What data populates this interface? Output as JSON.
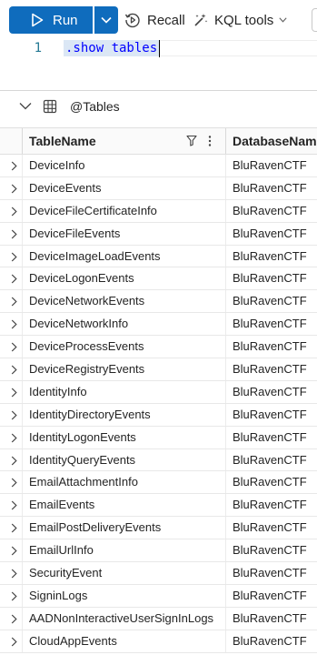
{
  "toolbar": {
    "run_label": "Run",
    "recall_label": "Recall",
    "kql_tools_label": "KQL tools"
  },
  "editor": {
    "line_number": "1",
    "query": ".show tables"
  },
  "results": {
    "title": "@Tables",
    "columns": [
      "TableName",
      "DatabaseName"
    ],
    "rows": [
      [
        "DeviceInfo",
        "BluRavenCTF"
      ],
      [
        "DeviceEvents",
        "BluRavenCTF"
      ],
      [
        "DeviceFileCertificateInfo",
        "BluRavenCTF"
      ],
      [
        "DeviceFileEvents",
        "BluRavenCTF"
      ],
      [
        "DeviceImageLoadEvents",
        "BluRavenCTF"
      ],
      [
        "DeviceLogonEvents",
        "BluRavenCTF"
      ],
      [
        "DeviceNetworkEvents",
        "BluRavenCTF"
      ],
      [
        "DeviceNetworkInfo",
        "BluRavenCTF"
      ],
      [
        "DeviceProcessEvents",
        "BluRavenCTF"
      ],
      [
        "DeviceRegistryEvents",
        "BluRavenCTF"
      ],
      [
        "IdentityInfo",
        "BluRavenCTF"
      ],
      [
        "IdentityDirectoryEvents",
        "BluRavenCTF"
      ],
      [
        "IdentityLogonEvents",
        "BluRavenCTF"
      ],
      [
        "IdentityQueryEvents",
        "BluRavenCTF"
      ],
      [
        "EmailAttachmentInfo",
        "BluRavenCTF"
      ],
      [
        "EmailEvents",
        "BluRavenCTF"
      ],
      [
        "EmailPostDeliveryEvents",
        "BluRavenCTF"
      ],
      [
        "EmailUrlInfo",
        "BluRavenCTF"
      ],
      [
        "SecurityEvent",
        "BluRavenCTF"
      ],
      [
        "SigninLogs",
        "BluRavenCTF"
      ],
      [
        "AADNonInteractiveUserSignInLogs",
        "BluRavenCTF"
      ],
      [
        "CloudAppEvents",
        "BluRavenCTF"
      ]
    ]
  },
  "icons": {
    "run": "play-icon",
    "run_dropdown": "chevron-down-icon",
    "recall": "recall-icon",
    "kql_tools": "magic-wand-icon",
    "collapse": "chevron-down-icon",
    "table": "table-icon",
    "filter": "filter-icon",
    "more": "more-vertical-icon",
    "row_expand": "chevron-right-icon"
  },
  "colors": {
    "accent": "#0f6cbd",
    "code": "#0000ff",
    "line_number": "#237893"
  }
}
